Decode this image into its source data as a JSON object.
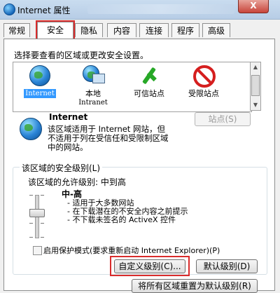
{
  "window": {
    "title": "Internet 属性",
    "close_label": "X"
  },
  "tabs": [
    {
      "label": "常规",
      "active": false
    },
    {
      "label": "安全",
      "active": true
    },
    {
      "label": "隐私",
      "active": false
    },
    {
      "label": "内容",
      "active": false
    },
    {
      "label": "连接",
      "active": false
    },
    {
      "label": "程序",
      "active": false
    },
    {
      "label": "高级",
      "active": false
    }
  ],
  "zones": {
    "prompt": "选择要查看的区域或更改安全设置。",
    "items": [
      {
        "label": "Internet",
        "icon": "globe-icon",
        "selected": true
      },
      {
        "label": "本地 Intranet",
        "label_line1": "本地",
        "label_line2": "Intranet",
        "icon": "network-icon",
        "selected": false
      },
      {
        "label": "可信站点",
        "icon": "checkmark-icon",
        "selected": false
      },
      {
        "label": "受限站点",
        "icon": "prohibited-icon",
        "selected": false
      }
    ]
  },
  "zone_info": {
    "name": "Internet",
    "description_lines": [
      "该区域适用于 Internet 网站，但",
      "不适用于列在受信任和受限制区域",
      "中的网站。"
    ],
    "sites_button": "站点(S)"
  },
  "security_level": {
    "group_title": "该区域的安全级别(L)",
    "allowed_label": "该区域的允许级别: 中到高",
    "level_name": "中-高",
    "slider_value": 0.5,
    "bullets": [
      "- 适用于大多数网站",
      "- 在下载潜在的不安全内容之前提示",
      "- 不下载未签名的 ActiveX 控件"
    ],
    "protected_mode_label": "启用保护模式(要求重新启动 Internet Explorer)(P)",
    "protected_mode_checked": false,
    "custom_button": "自定义级别(C)...",
    "default_button": "默认级别(D)"
  },
  "reset_all_button": "将所有区域重置为默认级别(R)",
  "colors": {
    "highlight": "#d92c2c",
    "selection": "#3399ff"
  }
}
